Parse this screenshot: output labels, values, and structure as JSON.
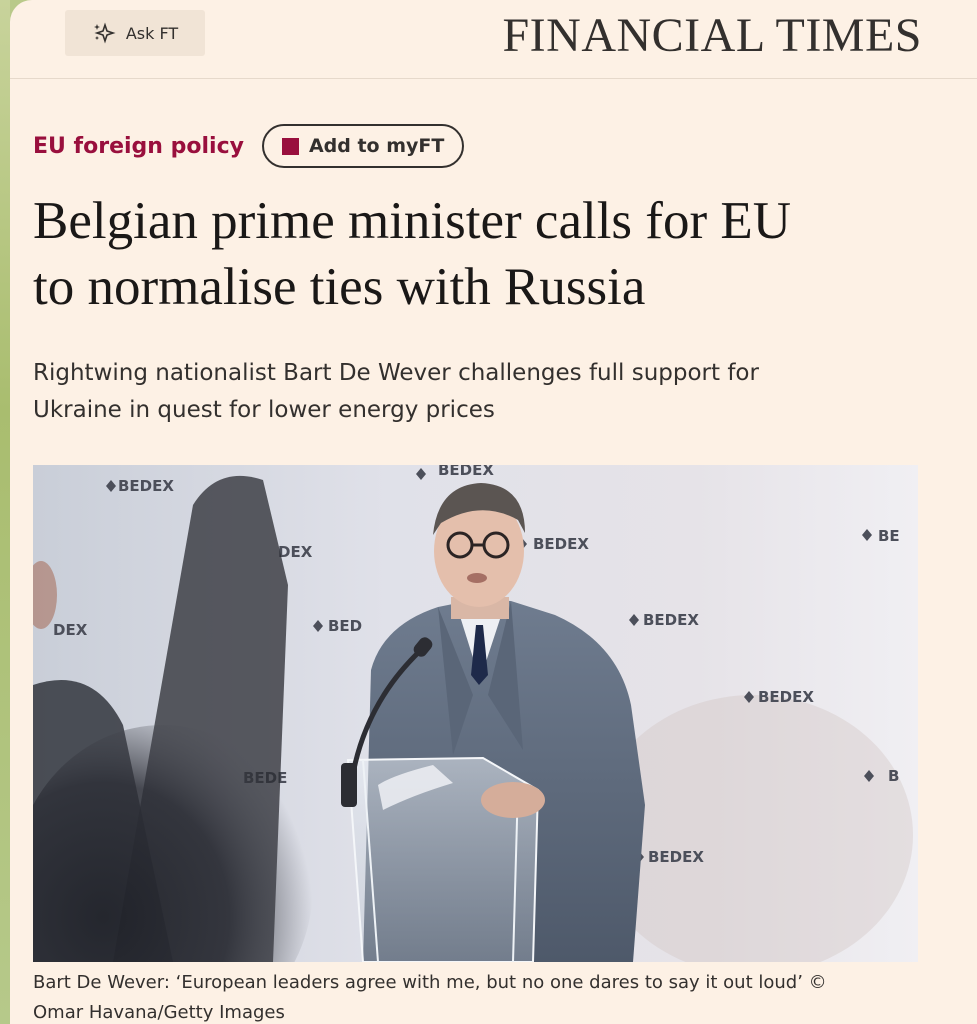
{
  "header": {
    "ask_label": "Ask FT",
    "ask_icon": "sparkle-icon",
    "brand": "FINANCIAL TIMES"
  },
  "article": {
    "topic": "EU foreign policy",
    "myft_label": "Add to myFT",
    "headline_line1": "Belgian prime minister calls for EU",
    "headline_line2": "to normalise ties with Russia",
    "standfirst_line1": "Rightwing nationalist Bart De Wever challenges full support for",
    "standfirst_line2": "Ukraine in quest for lower energy prices",
    "caption_line1": "Bart De Wever: ‘European leaders agree with me, but no one dares to say it out loud’ ©",
    "caption_line2": "Omar Havana/Getty Images"
  },
  "photo": {
    "backdrop_text": "BEDEX",
    "backdrop_partials": [
      "BEDEX",
      "DEX",
      "BEDE",
      "BED",
      "BE",
      "B"
    ]
  },
  "colors": {
    "page_bg": "#fdf1e5",
    "brand_claret": "#990f3d",
    "text_dark": "#33302e",
    "ask_bg": "#f1e4d6"
  }
}
